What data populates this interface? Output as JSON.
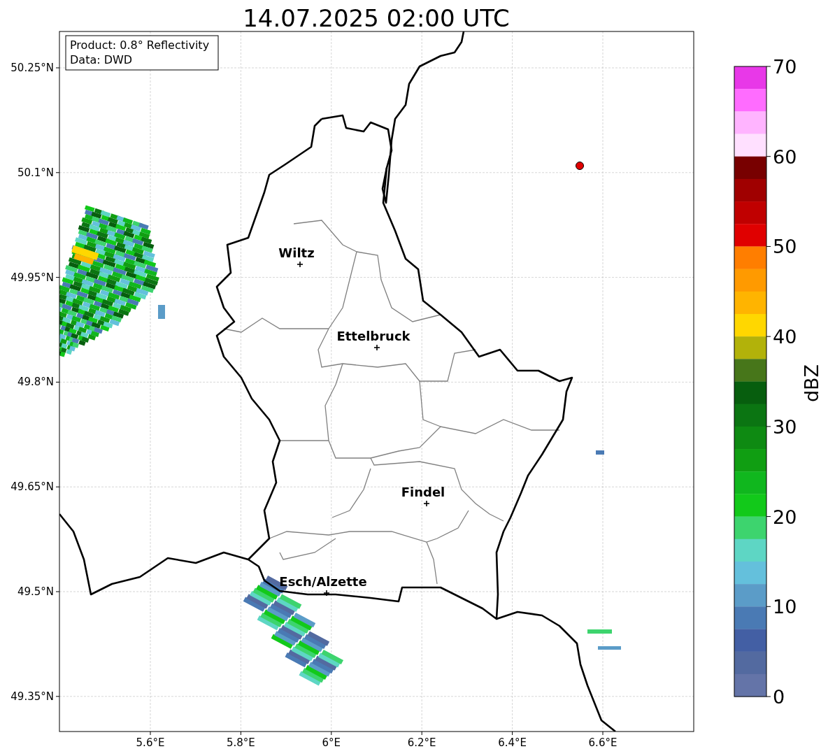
{
  "title": "14.07.2025 02:00 UTC",
  "legend": [
    "Product: 0.8° Reflectivity",
    "Data: DWD"
  ],
  "map": {
    "yticks": [
      "50.25°N",
      "50.1°N",
      "49.95°N",
      "49.8°N",
      "49.65°N",
      "49.5°N",
      "49.35°N"
    ],
    "xticks": [
      "5.6°E",
      "5.8°E",
      "6°E",
      "6.2°E",
      "6.4°E",
      "6.6°E"
    ],
    "cities": [
      "Wiltz",
      "Ettelbruck",
      "Findel",
      "Esch/Alzette"
    ],
    "radar_site": {
      "color": "#e00000"
    }
  },
  "colorbar": {
    "label": "dBZ",
    "ticks": [
      "70",
      "60",
      "50",
      "40",
      "30",
      "20",
      "10",
      "0"
    ],
    "bins": [
      {
        "color": "#e838e8"
      },
      {
        "color": "#ff6cff"
      },
      {
        "color": "#ffb4ff"
      },
      {
        "color": "#ffe0ff"
      },
      {
        "color": "#780000"
      },
      {
        "color": "#a00000"
      },
      {
        "color": "#c00000"
      },
      {
        "color": "#e00000"
      },
      {
        "color": "#ff7e00"
      },
      {
        "color": "#ff9a00"
      },
      {
        "color": "#ffb400"
      },
      {
        "color": "#ffd700"
      },
      {
        "color": "#b2b20a"
      },
      {
        "color": "#47761a"
      },
      {
        "color": "#075e0e"
      },
      {
        "color": "#0b7512"
      },
      {
        "color": "#0e8a12"
      },
      {
        "color": "#109e12"
      },
      {
        "color": "#10b71e"
      },
      {
        "color": "#12c91a"
      },
      {
        "color": "#3dd46e"
      },
      {
        "color": "#5ed6c4"
      },
      {
        "color": "#64c0dc"
      },
      {
        "color": "#5b9cc8"
      },
      {
        "color": "#4a7ab4"
      },
      {
        "color": "#435fa4"
      },
      {
        "color": "#536aa0"
      },
      {
        "color": "#6474a8"
      }
    ]
  }
}
